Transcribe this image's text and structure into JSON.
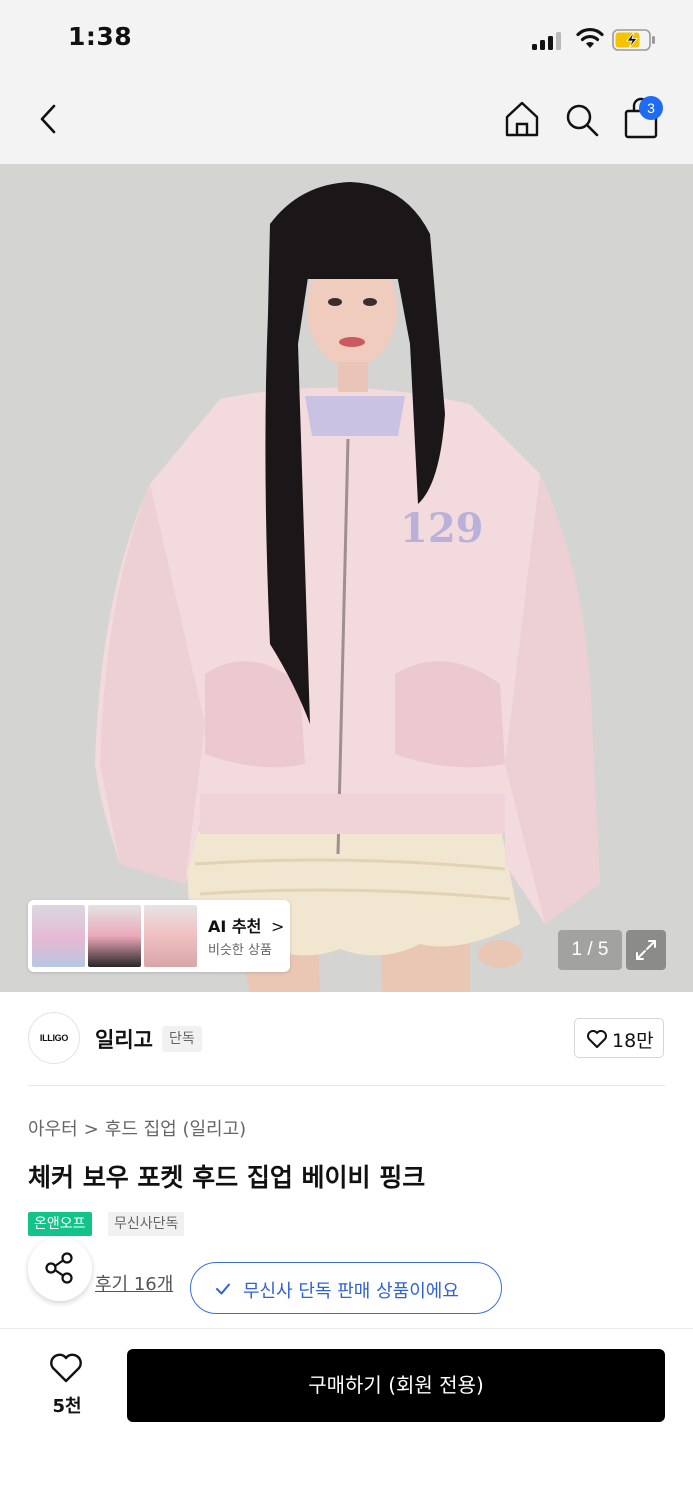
{
  "status_bar": {
    "time": "1:38"
  },
  "nav": {
    "cart_count": "3"
  },
  "hero": {
    "ai_recommend": {
      "title": "AI 추천",
      "arrow": ">",
      "subtitle": "비슷한 상품"
    },
    "page_indicator": "1 / 5"
  },
  "brand": {
    "logo_text": "ILLIGO",
    "name": "일리고",
    "tag": "단독",
    "likes": "18만"
  },
  "product": {
    "breadcrumb": [
      "아우터",
      "후드 집업 (일리고)"
    ],
    "breadcrumb_sep": ">",
    "title": "체커 보우 포켓 후드 집업 베이비 핑크",
    "badges": [
      "온앤오프",
      "무신사단독"
    ],
    "review_link": "후기 16개",
    "exclusive_notice": "무신사 단독 판매 상품이에요"
  },
  "bottom_bar": {
    "wish_count": "5천",
    "buy_label": "구매하기 (회원 전용)"
  },
  "colors": {
    "accent_blue": "#2e62d6",
    "badge_blue": "#1f6cf2",
    "badge_green": "#12c48a",
    "buy_button": "#000000"
  },
  "icons": [
    "back-icon",
    "home-icon",
    "search-icon",
    "shopping-bag-icon",
    "expand-icon",
    "heart-icon",
    "share-icon",
    "check-icon"
  ]
}
